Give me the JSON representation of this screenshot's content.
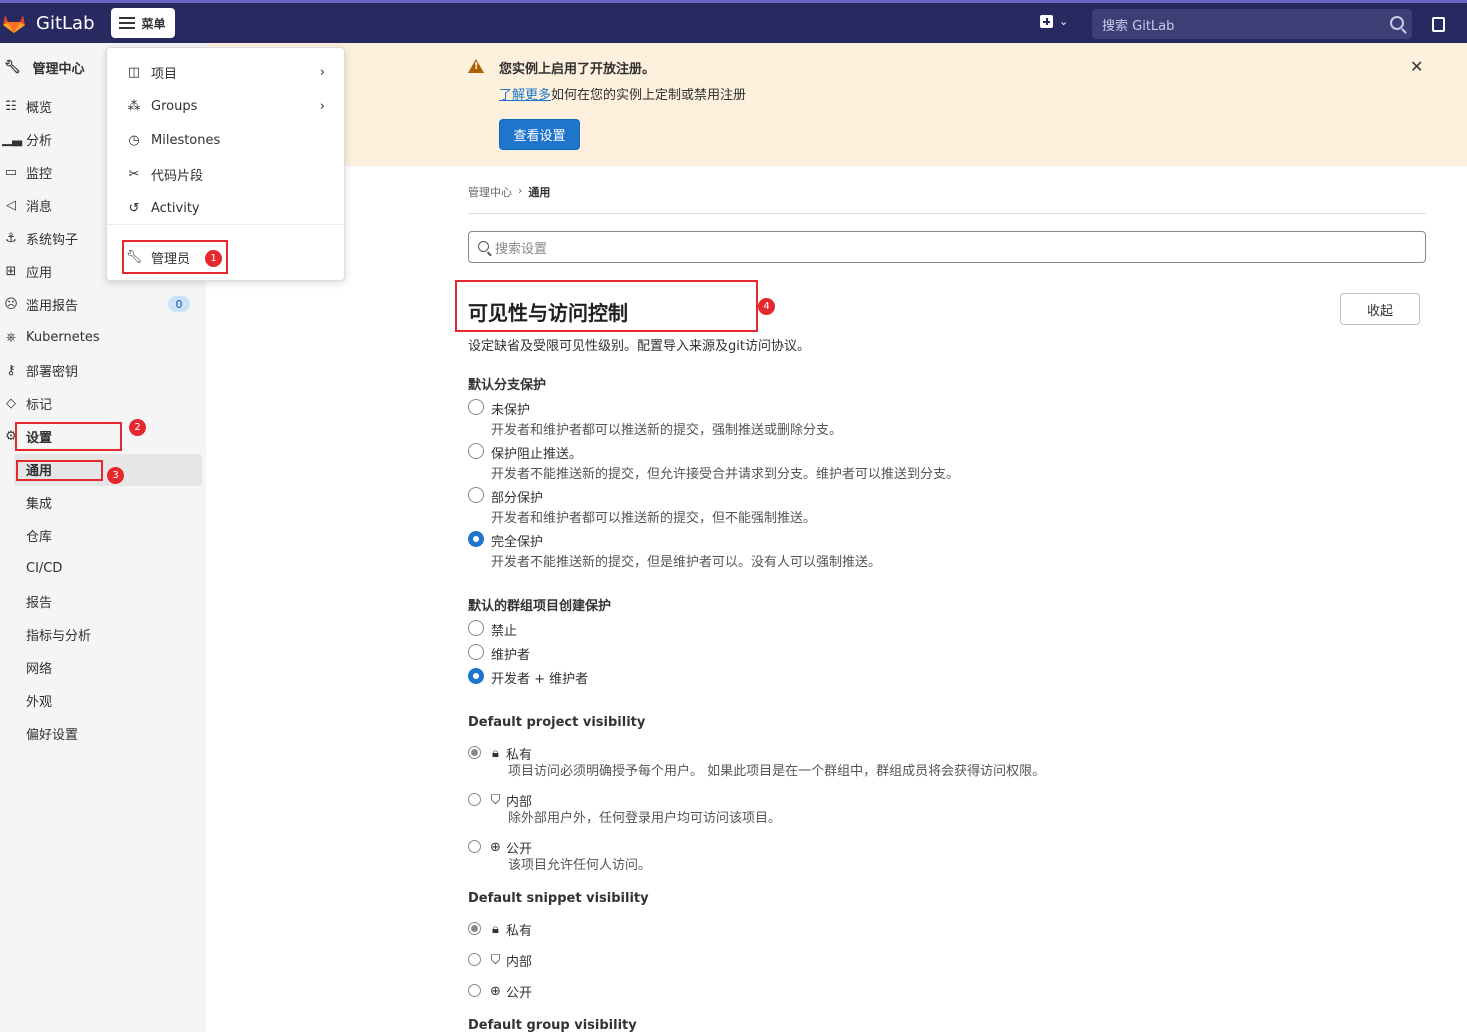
{
  "topbar": {
    "app_name": "GitLab",
    "menu_label": "菜单",
    "search_placeholder": "搜索 GitLab"
  },
  "dropdown": {
    "items": [
      {
        "label": "项目",
        "icon": "project-icon",
        "has_submenu": true
      },
      {
        "label": "Groups",
        "icon": "group-icon",
        "has_submenu": true
      },
      {
        "label": "Milestones",
        "icon": "clock-icon",
        "has_submenu": false
      },
      {
        "label": "代码片段",
        "icon": "scissors-icon",
        "has_submenu": false
      },
      {
        "label": "Activity",
        "icon": "history-icon",
        "has_submenu": false
      },
      {
        "label": "管理员",
        "icon": "wrench-icon",
        "has_submenu": false
      }
    ]
  },
  "sidebar": {
    "header": "管理中心",
    "items": [
      {
        "label": "概览",
        "icon": "overview-icon"
      },
      {
        "label": "分析",
        "icon": "chart-icon"
      },
      {
        "label": "监控",
        "icon": "monitor-icon"
      },
      {
        "label": "消息",
        "icon": "bullhorn-icon"
      },
      {
        "label": "系统钩子",
        "icon": "hook-icon"
      },
      {
        "label": "应用",
        "icon": "apps-icon"
      },
      {
        "label": "滥用报告",
        "icon": "abuse-icon",
        "badge": "0"
      },
      {
        "label": "Kubernetes",
        "icon": "kubernetes-icon"
      },
      {
        "label": "部署密钥",
        "icon": "key-icon"
      },
      {
        "label": "标记",
        "icon": "label-icon"
      },
      {
        "label": "设置",
        "icon": "settings-icon"
      }
    ],
    "settings_sub": [
      "通用",
      "集成",
      "仓库",
      "CI/CD",
      "报告",
      "指标与分析",
      "网络",
      "外观",
      "偏好设置"
    ]
  },
  "alert": {
    "title": "您实例上启用了开放注册。",
    "link": "了解更多",
    "body": "如何在您的实例上定制或禁用注册",
    "button": "查看设置"
  },
  "breadcrumb": {
    "parent": "管理中心",
    "current": "通用"
  },
  "search_settings_placeholder": "搜索设置",
  "section": {
    "title": "可见性与访问控制",
    "description": "设定缺省及受限可见性级别。配置导入来源及git访问协议。",
    "collapse": "收起"
  },
  "branch_protection": {
    "label": "默认分支保护",
    "options": [
      {
        "label": "未保护",
        "help": "开发者和维护者都可以推送新的提交，强制推送或删除分支。",
        "checked": false
      },
      {
        "label": "保护阻止推送。",
        "help": "开发者不能推送新的提交，但允许接受合并请求到分支。维护者可以推送到分支。",
        "checked": false
      },
      {
        "label": "部分保护",
        "help": "开发者和维护者都可以推送新的提交，但不能强制推送。",
        "checked": false
      },
      {
        "label": "完全保护",
        "help": "开发者不能推送新的提交，但是维护者可以。没有人可以强制推送。",
        "checked": true
      }
    ]
  },
  "group_creation": {
    "label": "默认的群组项目创建保护",
    "options": [
      {
        "label": "禁止",
        "checked": false
      },
      {
        "label": "维护者",
        "checked": false
      },
      {
        "label": "开发者 + 维护者",
        "checked": true
      }
    ]
  },
  "project_visibility": {
    "label": "Default project visibility",
    "options": [
      {
        "label": "私有",
        "icon": "lock-icon",
        "help": "项目访问必须明确授予每个用户。 如果此项目是在一个群组中，群组成员将会获得访问权限。",
        "checked": true
      },
      {
        "label": "内部",
        "icon": "shield-icon",
        "help": "除外部用户外，任何登录用户均可访问该项目。",
        "checked": false
      },
      {
        "label": "公开",
        "icon": "globe-icon",
        "help": "该项目允许任何人访问。",
        "checked": false
      }
    ]
  },
  "snippet_visibility": {
    "label": "Default snippet visibility",
    "options": [
      {
        "label": "私有",
        "icon": "lock-icon",
        "checked": true
      },
      {
        "label": "内部",
        "icon": "shield-icon",
        "checked": false
      },
      {
        "label": "公开",
        "icon": "globe-icon",
        "checked": false
      }
    ]
  },
  "group_visibility": {
    "label": "Default group visibility"
  },
  "annotations": [
    "1",
    "2",
    "3",
    "4"
  ],
  "colors": {
    "topbar": "#292961",
    "accent": "#1f75cb",
    "alert_bg": "#fdf1dd",
    "annotation": "#e5282e"
  }
}
